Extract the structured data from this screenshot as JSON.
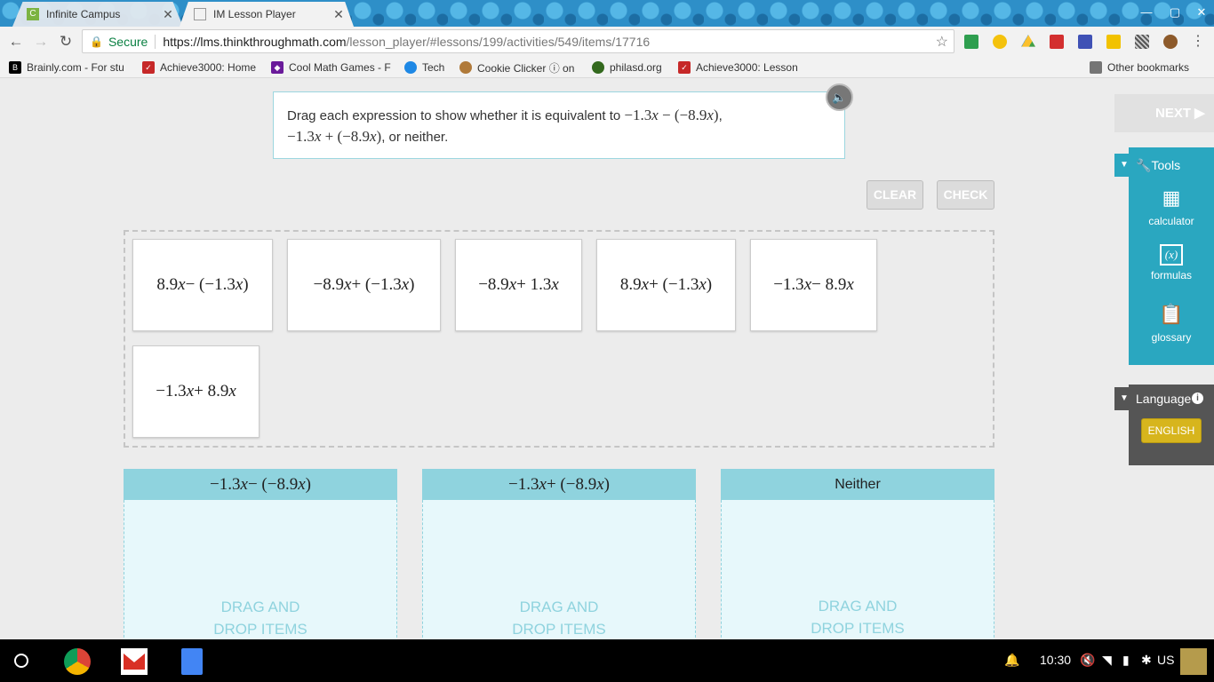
{
  "browser": {
    "tabs": [
      {
        "title": "Infinite Campus",
        "favicon": "C",
        "active": false
      },
      {
        "title": "IM Lesson Player",
        "favicon": "",
        "active": true
      }
    ],
    "address": {
      "secure_label": "Secure",
      "url_host": "https://lms.thinkthroughmath.com",
      "url_path": "/lesson_player/#lessons/199/activities/549/items/17716"
    },
    "bookmarks": [
      "Brainly.com - For stu",
      "Achieve3000: Home",
      "Cool Math Games - F",
      "Tech",
      "Cookie Clicker ⓘ on",
      "philasd.org",
      "Achieve3000: Lesson"
    ],
    "other_bookmarks": "Other bookmarks"
  },
  "lesson": {
    "prompt_start": "Drag each expression to show whether it is equivalent to",
    "prompt_expr1_parts": [
      "−1.3",
      "x",
      " − (−8.9",
      "x",
      ")"
    ],
    "prompt_comma": ",",
    "prompt_expr2_parts": [
      "−1.3",
      "x",
      " + (−8.9",
      "x",
      ")"
    ],
    "prompt_end": ", or neither.",
    "clear_label": "CLEAR",
    "check_label": "CHECK",
    "next_label": "NEXT ▶",
    "cards": [
      [
        "8.9",
        "x",
        " − (−1.3",
        "x",
        ")"
      ],
      [
        "−8.9",
        "x",
        " + (−1.3",
        "x",
        ")"
      ],
      [
        "−8.9",
        "x",
        " + 1.3",
        "x",
        ""
      ],
      [
        "8.9",
        "x",
        " + (−1.3",
        "x",
        ")"
      ],
      [
        "−1.3",
        "x",
        " − 8.9",
        "x",
        ""
      ],
      [
        "−1.3",
        "x",
        " + 8.9",
        "x",
        ""
      ]
    ],
    "bins": [
      {
        "header_parts": [
          "−1.3",
          "x",
          " − (−8.9",
          "x",
          ")"
        ],
        "hint_line1": "DRAG AND",
        "hint_line2": "DROP ITEMS"
      },
      {
        "header_parts": [
          "−1.3",
          "x",
          " + (−8.9",
          "x",
          ")"
        ],
        "hint_line1": "DRAG AND",
        "hint_line2": "DROP ITEMS"
      },
      {
        "header_text": "Neither",
        "hint_line1": "DRAG AND",
        "hint_line2": "DROP ITEMS"
      }
    ]
  },
  "tools": {
    "title": "Tools",
    "items": [
      {
        "label": "calculator",
        "icon": "calculator-icon"
      },
      {
        "label": "formulas",
        "icon": "formulas-icon"
      },
      {
        "label": "glossary",
        "icon": "glossary-icon"
      }
    ],
    "formulas_icon_text": "(x)"
  },
  "language": {
    "title": "Language",
    "button": "ENGLISH"
  },
  "taskbar": {
    "time": "10:30",
    "locale": "US"
  },
  "colors": {
    "accent": "#2aa7c0",
    "bin_header": "#8fd3de",
    "bin_body": "#e7f8fb",
    "english_button": "#d7b51d"
  }
}
